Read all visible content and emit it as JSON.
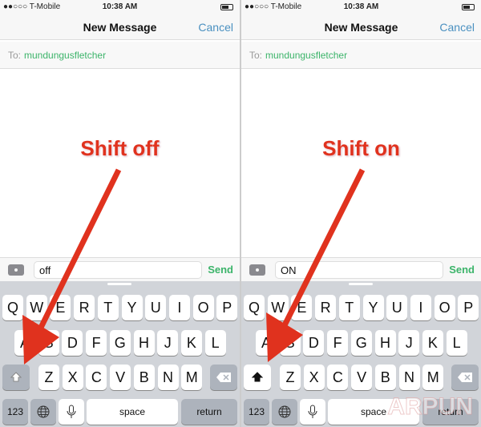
{
  "status": {
    "carrier": "●●○○○ T-Mobile",
    "wifi": "wifi-icon",
    "time": "10:38 AM"
  },
  "nav": {
    "title": "New Message",
    "cancel": "Cancel"
  },
  "to": {
    "label": "To:",
    "recipient": "mundungusfletcher"
  },
  "send": "Send",
  "panels": [
    {
      "annotation": "Shift off",
      "field_value": "off",
      "shift_on": false
    },
    {
      "annotation": "Shift on",
      "field_value": "ON",
      "shift_on": true
    }
  ],
  "keyboard": {
    "row1": [
      "Q",
      "W",
      "E",
      "R",
      "T",
      "Y",
      "U",
      "I",
      "O",
      "P"
    ],
    "row2": [
      "A",
      "S",
      "D",
      "F",
      "G",
      "H",
      "J",
      "K",
      "L"
    ],
    "row3": [
      "Z",
      "X",
      "C",
      "V",
      "B",
      "N",
      "M"
    ],
    "numbers": "123",
    "space": "space",
    "return": "return",
    "shift_icon": "shift-arrow-icon",
    "delete_icon": "backspace-icon",
    "globe_icon": "globe-icon",
    "mic_icon": "microphone-icon"
  },
  "colors": {
    "accent_green": "#3cb46a",
    "cancel_blue": "#4a90c0",
    "annotation_red": "#e0321e"
  },
  "watermark": "ARPUN"
}
